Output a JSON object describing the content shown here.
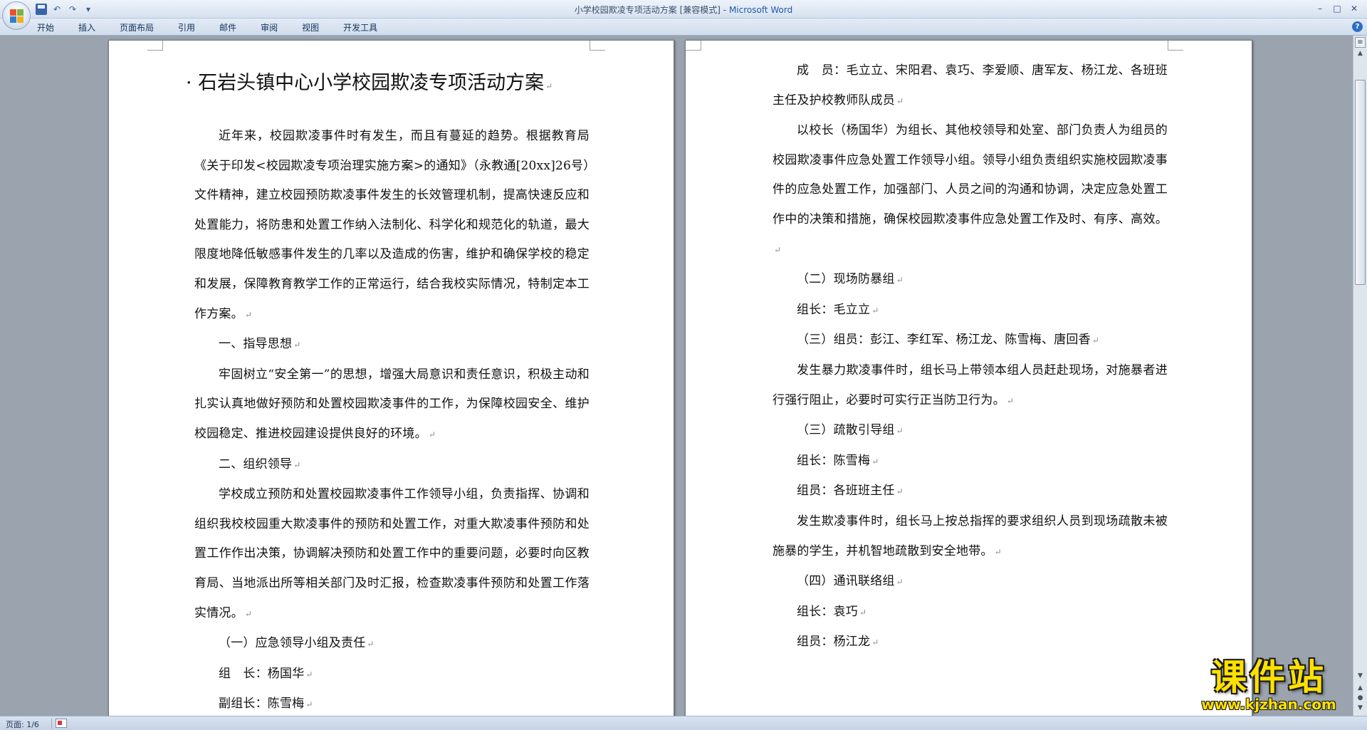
{
  "window": {
    "title": "小学校园欺凌专项活动方案 [兼容模式]",
    "title_sep": " - ",
    "app": "Microsoft Word"
  },
  "ribbon": {
    "tabs": [
      "开始",
      "插入",
      "页面布局",
      "引用",
      "邮件",
      "审阅",
      "视图",
      "开发工具"
    ]
  },
  "document": {
    "title": "· 石岩头镇中心小学校园欺凌专项活动方案",
    "left_page": [
      {
        "text": "近年来，校园欺凌事件时有发生，而且有蔓延的趋势。根据教育局《关于印发<校园欺凌专项治理实施方案>的通知》（永教通[20xx]26号）文件精神，建立校园预防欺凌事件发生的长效管理机制，提高快速反应和处置能力，将防患和处置工作纳入法制化、科学化和规范化的轨道，最大限度地降低敏感事件发生的几率以及造成的伤害，维护和确保学校的稳定和发展，保障教育教学工作的正常运行，结合我校实际情况，特制定本工作方案。",
        "indent": true
      },
      {
        "text": "一、指导思想",
        "indent": true
      },
      {
        "text": "牢固树立“安全第一”的思想，增强大局意识和责任意识，积极主动和扎实认真地做好预防和处置校园欺凌事件的工作，为保障校园安全、维护校园稳定、推进校园建设提供良好的环境。",
        "indent": true
      },
      {
        "text": "二、组织领导",
        "indent": true
      },
      {
        "text": "学校成立预防和处置校园欺凌事件工作领导小组，负责指挥、协调和组织我校校园重大欺凌事件的预防和处置工作，对重大欺凌事件预防和处置工作作出决策，协调解决预防和处置工作中的重要问题，必要时向区教育局、当地派出所等相关部门及时汇报，检查欺凌事件预防和处置工作落实情况。",
        "indent": true
      },
      {
        "text": "（一）应急领导小组及责任",
        "indent": true
      },
      {
        "text": "组　长：杨国华",
        "indent": true
      },
      {
        "text": "副组长：陈雪梅",
        "indent": true
      }
    ],
    "right_page": [
      {
        "text": "成　员：毛立立、宋阳君、袁巧、李爱顺、唐军友、杨江龙、各班班主任及护校教师队成员",
        "indent": true
      },
      {
        "text": "以校长（杨国华）为组长、其他校领导和处室、部门负责人为组员的校园欺凌事件应急处置工作领导小组。领导小组负责组织实施校园欺凌事件的应急处置工作，加强部门、人员之间的沟通和协调，决定应急处置工作中的决策和措施，确保校园欺凌事件应急处置工作及时、有序、高效。",
        "indent": true
      },
      {
        "text": "（二）现场防暴组",
        "indent": true
      },
      {
        "text": "组长：毛立立",
        "indent": true
      },
      {
        "text": "（三）组员：彭江、李红军、杨江龙、陈雪梅、唐回香",
        "indent": true
      },
      {
        "text": "发生暴力欺凌事件时，组长马上带领本组人员赶赴现场，对施暴者进行强行阻止，必要时可实行正当防卫行为。",
        "indent": true
      },
      {
        "text": "（三）疏散引导组",
        "indent": true
      },
      {
        "text": "组长：陈雪梅",
        "indent": true
      },
      {
        "text": "组员：各班班主任",
        "indent": true
      },
      {
        "text": "发生欺凌事件时，组长马上按总指挥的要求组织人员到现场疏散未被施暴的学生，并机智地疏散到安全地带。",
        "indent": true
      },
      {
        "text": "（四）通讯联络组",
        "indent": true
      },
      {
        "text": "组长：袁巧",
        "indent": true
      },
      {
        "text": "组员：杨江龙",
        "indent": true
      }
    ],
    "paragraph_mark": "↵"
  },
  "statusbar": {
    "page": "页面: 1/6"
  },
  "watermark": {
    "name": "课件站",
    "url": "www.kjzhan.com"
  },
  "icons": {
    "office_button": "office-logo-icon",
    "save": "save-icon",
    "undo": "undo-icon",
    "redo": "redo-icon",
    "help": "help-icon"
  }
}
